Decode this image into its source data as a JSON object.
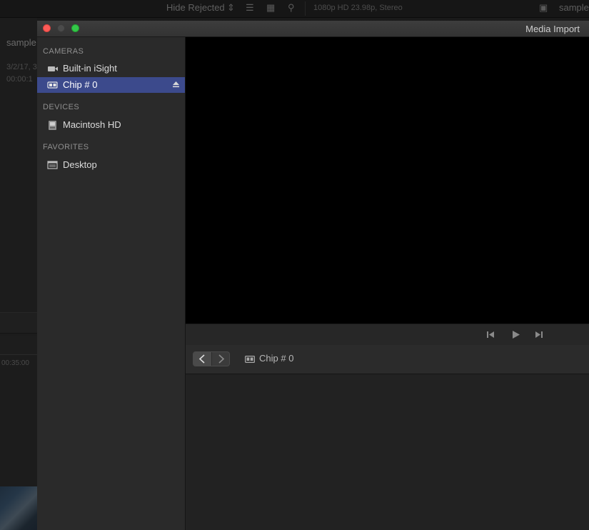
{
  "background_app": {
    "filter_label": "Hide Rejected",
    "format_info": "1080p HD 23.98p, Stereo",
    "project_name": "sample",
    "clip_name": "sample",
    "clip_date": "3/2/17, 3",
    "clip_duration": "00:00:1",
    "timecode": "00:35:00"
  },
  "window": {
    "title": "Media Import"
  },
  "sidebar": {
    "sections": [
      {
        "header": "CAMERAS",
        "items": [
          {
            "label": "Built-in iSight",
            "icon": "camera-icon",
            "selected": false
          },
          {
            "label": "Chip # 0",
            "icon": "card-icon",
            "selected": true,
            "eject": true
          }
        ]
      },
      {
        "header": "DEVICES",
        "items": [
          {
            "label": "Macintosh HD",
            "icon": "hard-drive-icon",
            "selected": false
          }
        ]
      },
      {
        "header": "FAVORITES",
        "items": [
          {
            "label": "Desktop",
            "icon": "desktop-icon",
            "selected": false
          }
        ]
      }
    ]
  },
  "transport": {
    "buttons": [
      "skip-back-icon",
      "play-icon",
      "skip-forward-icon"
    ]
  },
  "browser": {
    "breadcrumb": "Chip # 0",
    "breadcrumb_icon": "card-icon"
  },
  "colors": {
    "selection": "#3c4a8c",
    "close": "#fc5b57",
    "zoom": "#34c749"
  }
}
